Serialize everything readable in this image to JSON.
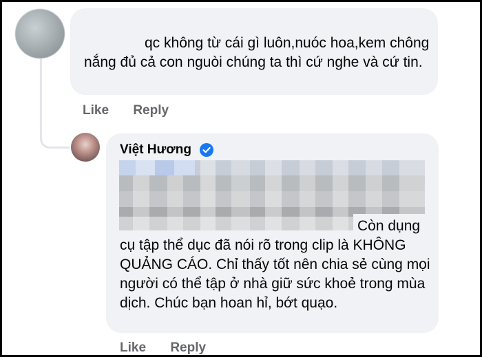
{
  "comment": {
    "text": "qc không từ cái gì luôn,nuóc hoa,kem chông nắng đủ cả con nguòi chúng ta thì cứ nghe và cứ tin.",
    "actions": {
      "like": "Like",
      "reply": "Reply"
    }
  },
  "reply": {
    "author": "Việt Hương",
    "text": "Còn dụng cụ tập thể dục đã nói rõ trong clip là KHÔNG QUẢNG CÁO. Chỉ thấy tốt nên chia sẻ cùng mọi người có thể tập ở nhà giữ sức khoẻ trong mùa dịch. Chúc bạn hoan hỉ, bớt quạo.",
    "actions": {
      "like": "Like",
      "reply": "Reply"
    }
  },
  "colors": {
    "bubble": "#f0f2f5",
    "action_text": "#65676b",
    "verified_badge": "#1877f2",
    "text": "#050505"
  },
  "icons": {
    "verified": "verified-badge-icon"
  }
}
